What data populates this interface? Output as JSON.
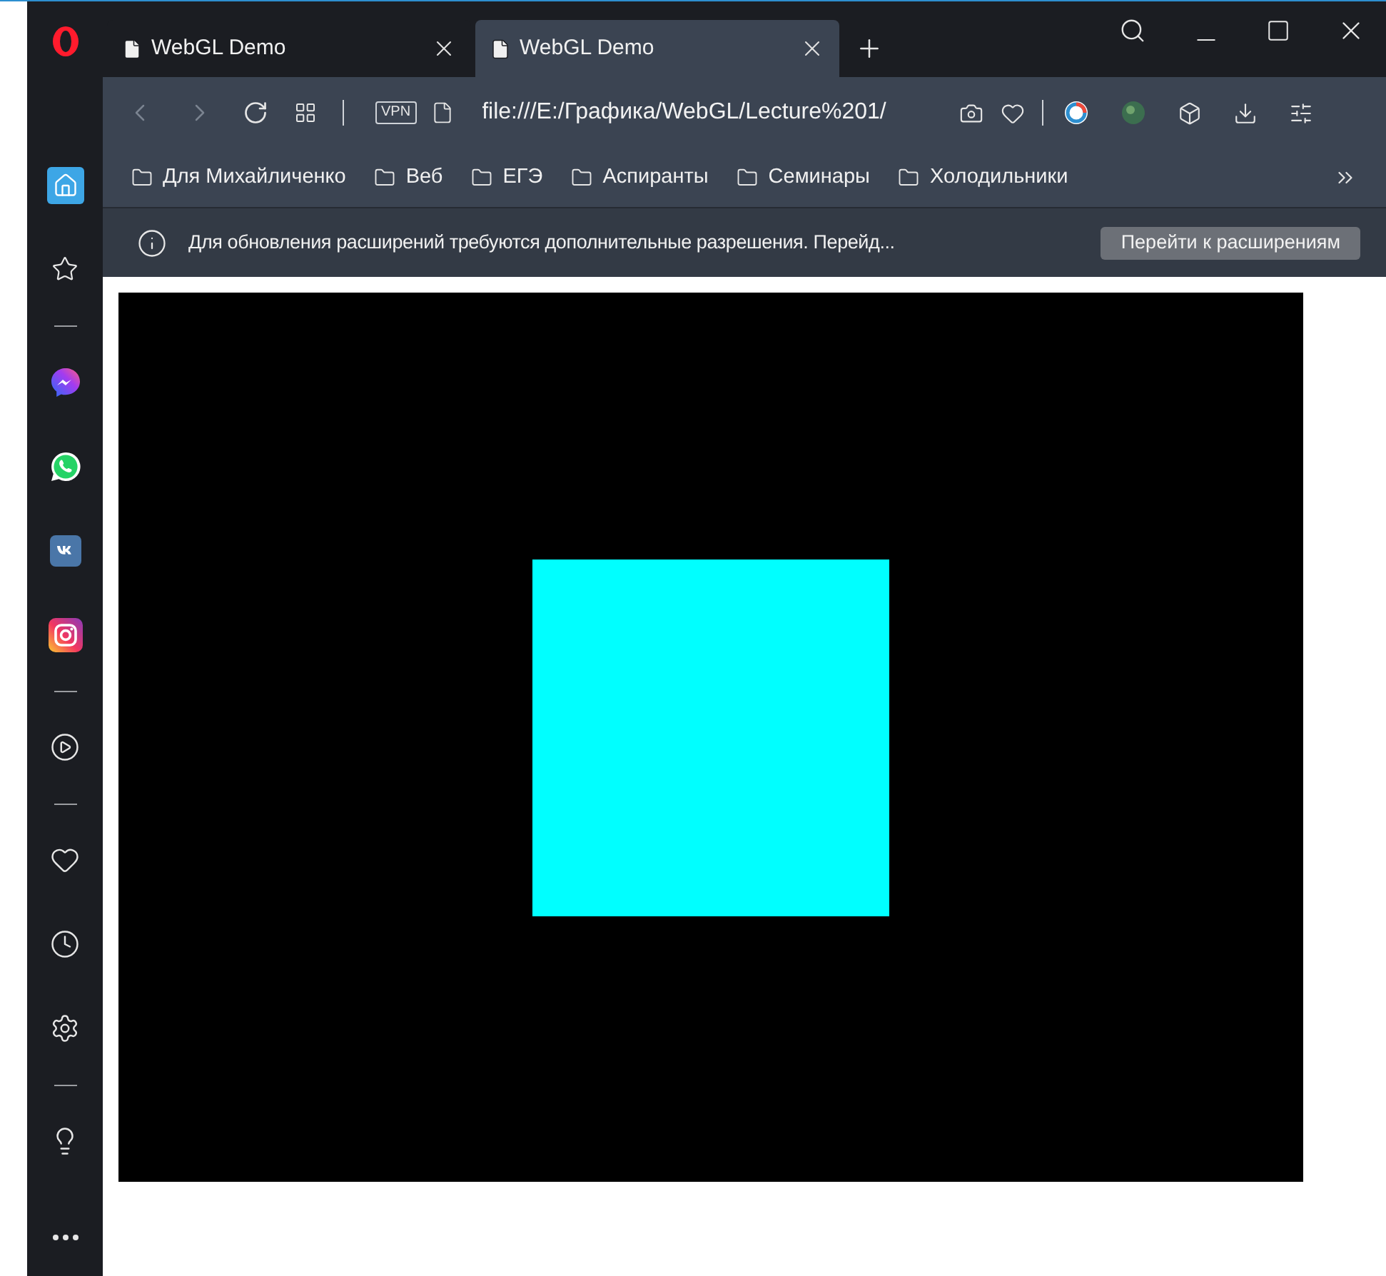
{
  "tabs": [
    {
      "title": "WebGL Demo",
      "selected": false
    },
    {
      "title": "WebGL Demo",
      "selected": true
    }
  ],
  "address_bar": {
    "vpn_badge": "VPN",
    "url": "file:///E:/Графика/WebGL/Lecture%201/"
  },
  "bookmarks": [
    {
      "label": "Для Михайличенко"
    },
    {
      "label": "Веб"
    },
    {
      "label": "ЕГЭ"
    },
    {
      "label": "Аспиранты"
    },
    {
      "label": "Семинары"
    },
    {
      "label": "Холодильники"
    }
  ],
  "info_bar": {
    "message": "Для обновления расширений требуются дополнительные разрешения. Перейд...",
    "button": "Перейти к расширениям"
  },
  "sidebar": {
    "items": [
      {
        "kind": "home",
        "selected": true
      },
      {
        "kind": "bookmarks",
        "selected": false
      },
      {
        "kind": "divider"
      },
      {
        "kind": "messenger",
        "selected": false
      },
      {
        "kind": "whatsapp",
        "selected": false
      },
      {
        "kind": "vk",
        "selected": false
      },
      {
        "kind": "instagram",
        "selected": false
      },
      {
        "kind": "divider"
      },
      {
        "kind": "player",
        "selected": false
      },
      {
        "kind": "divider"
      },
      {
        "kind": "favorites",
        "selected": false
      },
      {
        "kind": "history",
        "selected": false
      },
      {
        "kind": "settings",
        "selected": false
      },
      {
        "kind": "divider"
      },
      {
        "kind": "tips",
        "selected": false
      },
      {
        "kind": "more",
        "selected": false
      }
    ]
  }
}
